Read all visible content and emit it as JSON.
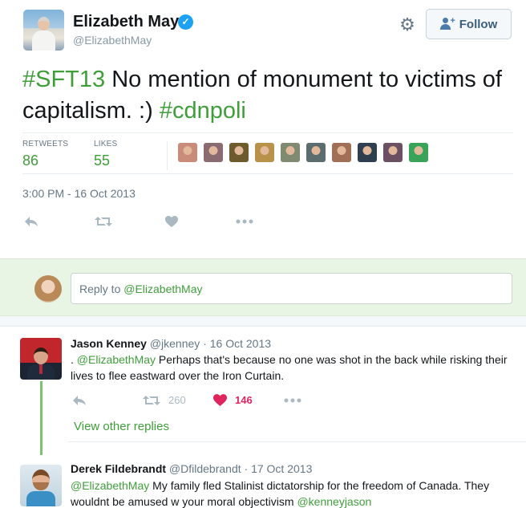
{
  "tweet": {
    "display_name": "Elizabeth May",
    "handle": "@ElizabethMay",
    "follow_label": "Follow",
    "text_parts": [
      {
        "type": "hashtag",
        "text": "#SFT13"
      },
      {
        "type": "text",
        "text": " No mention of monument to victims of capitalism. :) "
      },
      {
        "type": "hashtag",
        "text": "#cdnpoli"
      }
    ],
    "stats": {
      "retweets_label": "RETWEETS",
      "retweets_value": "86",
      "likes_label": "LIKES",
      "likes_value": "55"
    },
    "liker_avatar_colors": [
      "#c98b7a",
      "#8a6b72",
      "#6d5a2d",
      "#b79248",
      "#7f8a70",
      "#5b6d6f",
      "#a06f55",
      "#2f3f4f",
      "#6b4f63",
      "#3aa35a"
    ],
    "timestamp": "3:00 PM - 16 Oct 2013",
    "actions": [
      "reply-icon",
      "retweet-icon",
      "like-icon",
      "more-icon"
    ],
    "accent_color": "#3f9e3a"
  },
  "reply_box": {
    "placeholder_prefix": "Reply to ",
    "placeholder_mention": "@ElizabethMay"
  },
  "replies": [
    {
      "name": "Jason Kenney",
      "handle": "@jkenney",
      "date": "16 Oct 2013",
      "text_prefix": ". ",
      "mention": "@ElizabethMay",
      "text": " Perhaps that's because no one was shot in the back while risking their lives to flee eastward over the Iron Curtain.",
      "retweets": "260",
      "likes": "146",
      "view_other_replies": "View other replies"
    },
    {
      "name": "Derek Fildebrandt",
      "handle": "@Dfildebrandt",
      "date": "17 Oct 2013",
      "mention": "@ElizabethMay",
      "text": " My family fled Stalinist dictatorship for the freedom of Canada. They wouldnt be amused w your moral objectivism ",
      "mention_end": "@kenneyjason"
    }
  ]
}
